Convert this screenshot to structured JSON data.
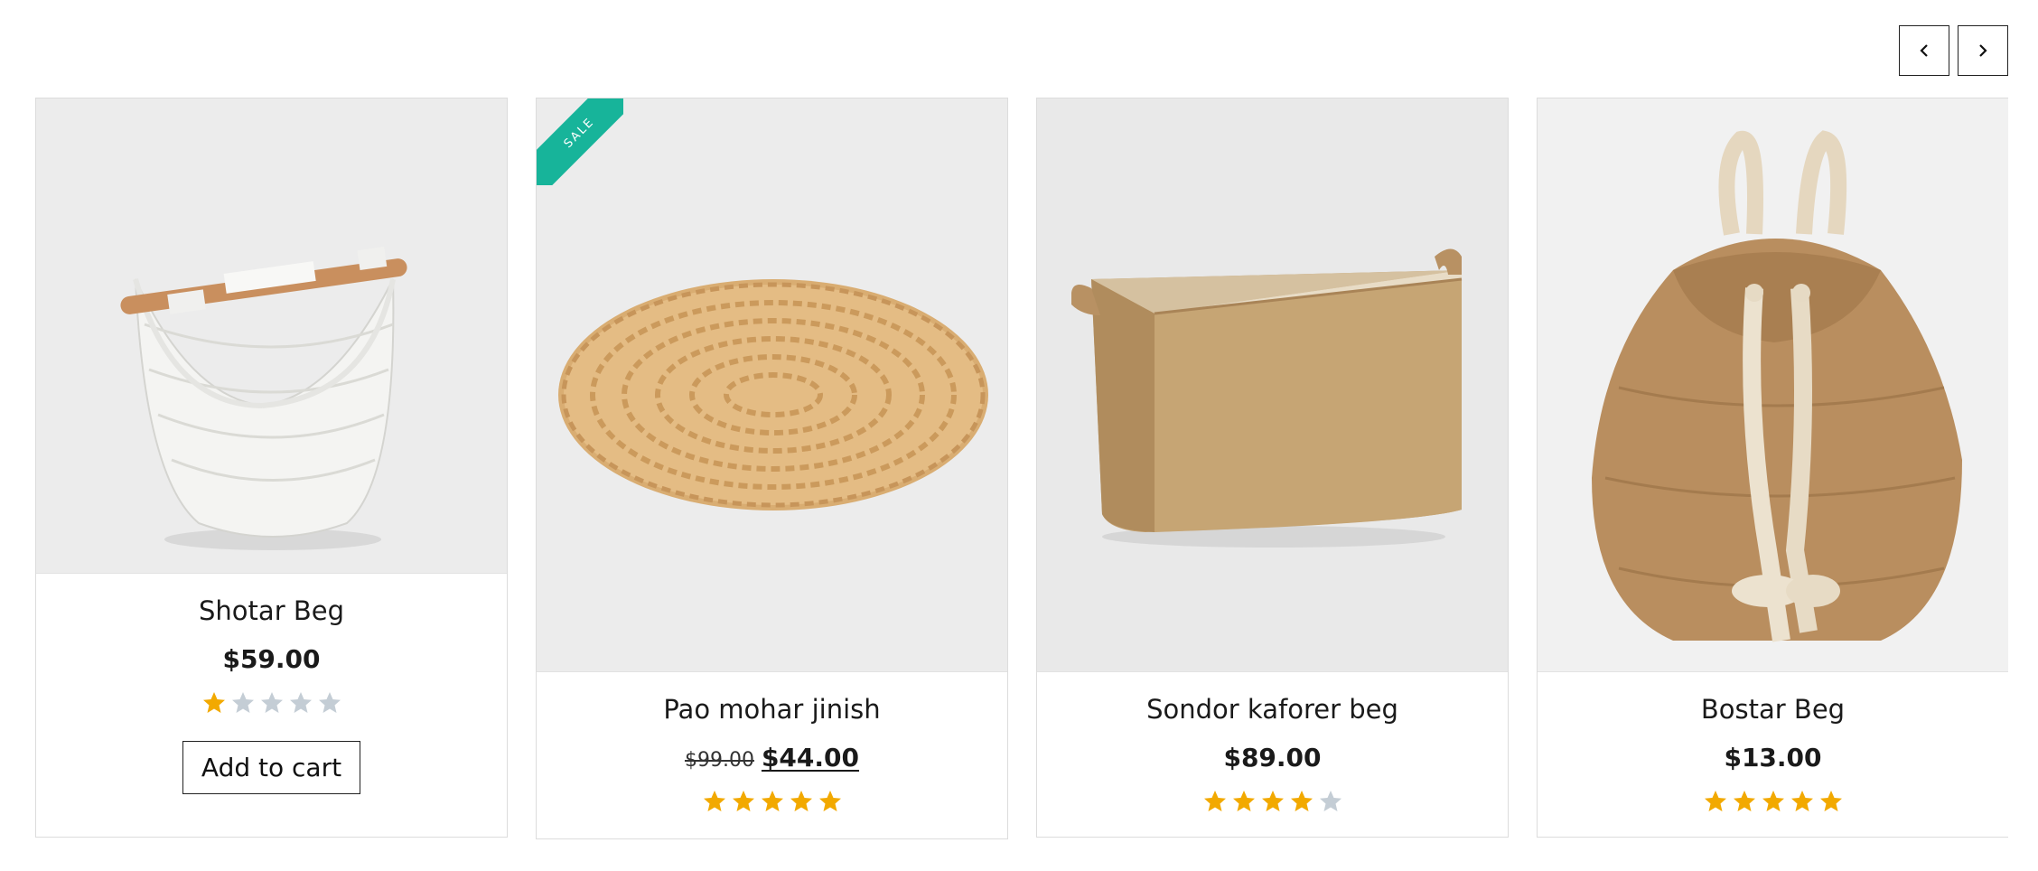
{
  "carousel": {
    "prev_icon": "chevron-left-icon",
    "next_icon": "chevron-right-icon"
  },
  "products": [
    {
      "name": "Shotar Beg",
      "price": "$59.00",
      "old_price": "",
      "rating": 1,
      "max_rating": 5,
      "on_sale": false,
      "cta": "Add to cart",
      "image": "white woven basket with wooden handle"
    },
    {
      "name": "Pao mohar jinish",
      "price": "$44.00",
      "old_price": "$99.00",
      "rating": 5,
      "max_rating": 5,
      "on_sale": true,
      "sale_label": "SALE",
      "image": "oval braided jute doormat"
    },
    {
      "name": "Sondor kaforer beg",
      "price": "$89.00",
      "old_price": "",
      "rating": 4,
      "max_rating": 5,
      "on_sale": false,
      "image": "jute storage bin with handles"
    },
    {
      "name": "Bostar Beg",
      "price": "$13.00",
      "old_price": "",
      "rating": 5,
      "max_rating": 5,
      "on_sale": false,
      "image": "woven drawstring backpack with rope straps"
    }
  ],
  "colors": {
    "star_filled": "#f2a900",
    "star_empty": "#c4cdd5",
    "sale_ribbon": "#17b49a",
    "card_border": "#dcdcdc",
    "image_bg": "#ececec"
  }
}
